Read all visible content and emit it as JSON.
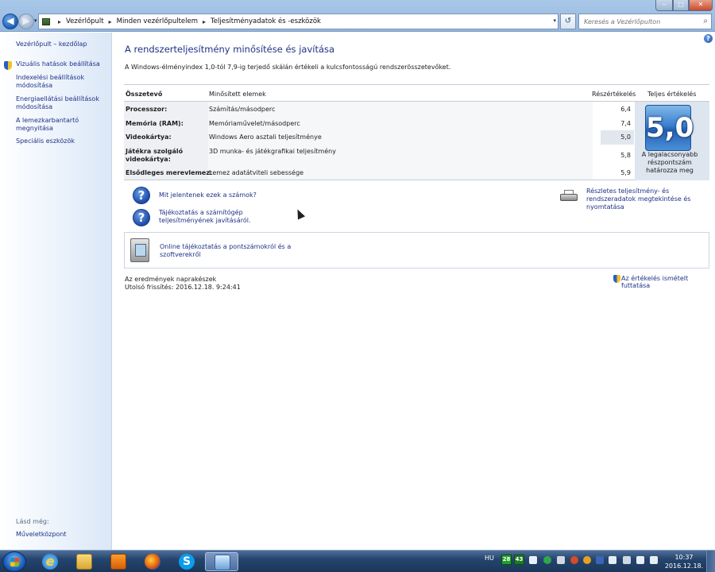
{
  "window": {
    "breadcrumbs": [
      "Vezérlőpult",
      "Minden vezérlőpultelem",
      "Teljesítményadatok és -eszközök"
    ],
    "search_placeholder": "Keresés a Vezérlőpulton",
    "controls": {
      "minimize": "‒",
      "maximize": "□",
      "close": "✕"
    },
    "nav": {
      "back": "◀",
      "forward": "▶",
      "history": "▾",
      "refresh": "↺",
      "dropdown": "▾"
    }
  },
  "sidebar": {
    "home": "Vezérlőpult – kezdőlap",
    "items": [
      "Vizuális hatások beállítása",
      "Indexelési beállítások módosítása",
      "Energiaellátási beállítások módosítása",
      "A lemezkarbantartó megnyitása",
      "Speciális eszközök"
    ],
    "see_also_header": "Lásd még:",
    "see_also": "Műveletközpont"
  },
  "main": {
    "title": "A rendszerteljesítmény minősítése és javítása",
    "intro": "A Windows-élményindex 1,0-tól 7,9-ig terjedő skálán értékeli a kulcsfontosságú rendszerösszetevőket.",
    "table": {
      "headers": {
        "component": "Összetevő",
        "rated": "Minősített elemek",
        "subscore": "Részértékelés",
        "base": "Teljes értékelés"
      },
      "rows": [
        {
          "component": "Processzor:",
          "rated": "Számítás/másodperc",
          "subscore": "6,4"
        },
        {
          "component": "Memória (RAM):",
          "rated": "Memóriaművelet/másodperc",
          "subscore": "7,4"
        },
        {
          "component": "Videokártya:",
          "rated": "Windows Aero asztali teljesítménye",
          "subscore": "5,0"
        },
        {
          "component": "Játékra szolgáló videokártya:",
          "rated": "3D munka- és játékgrafikai teljesítmény",
          "subscore": "5,8"
        },
        {
          "component": "Elsődleges merevlemez:",
          "rated": "Lemez adatátviteli sebessége",
          "subscore": "5,9"
        }
      ],
      "base_score": "5,0",
      "base_caption": "A legalacsonyabb részpontszám határozza meg"
    },
    "links": {
      "what_numbers": "Mit jelentenek ezek a számok?",
      "tips": "Tájékoztatás a számítógép teljesítményének javításáról.",
      "details": "Részletes teljesítmény- és rendszeradatok megtekintése és nyomtatása",
      "online": "Online tájékoztatás a pontszámokról és a szoftverekről",
      "rerun": "Az értékelés ismételt futtatása"
    },
    "status": "Az eredmények naprakészek",
    "last_update": "Utolsó frissítés: 2016.12.18. 9:24:41"
  },
  "taskbar": {
    "language": "HU",
    "tray_badges": [
      "28",
      "43"
    ],
    "time": "10:37",
    "date": "2016.12.18.",
    "skype_letter": "S",
    "ie_letter": "e"
  }
}
